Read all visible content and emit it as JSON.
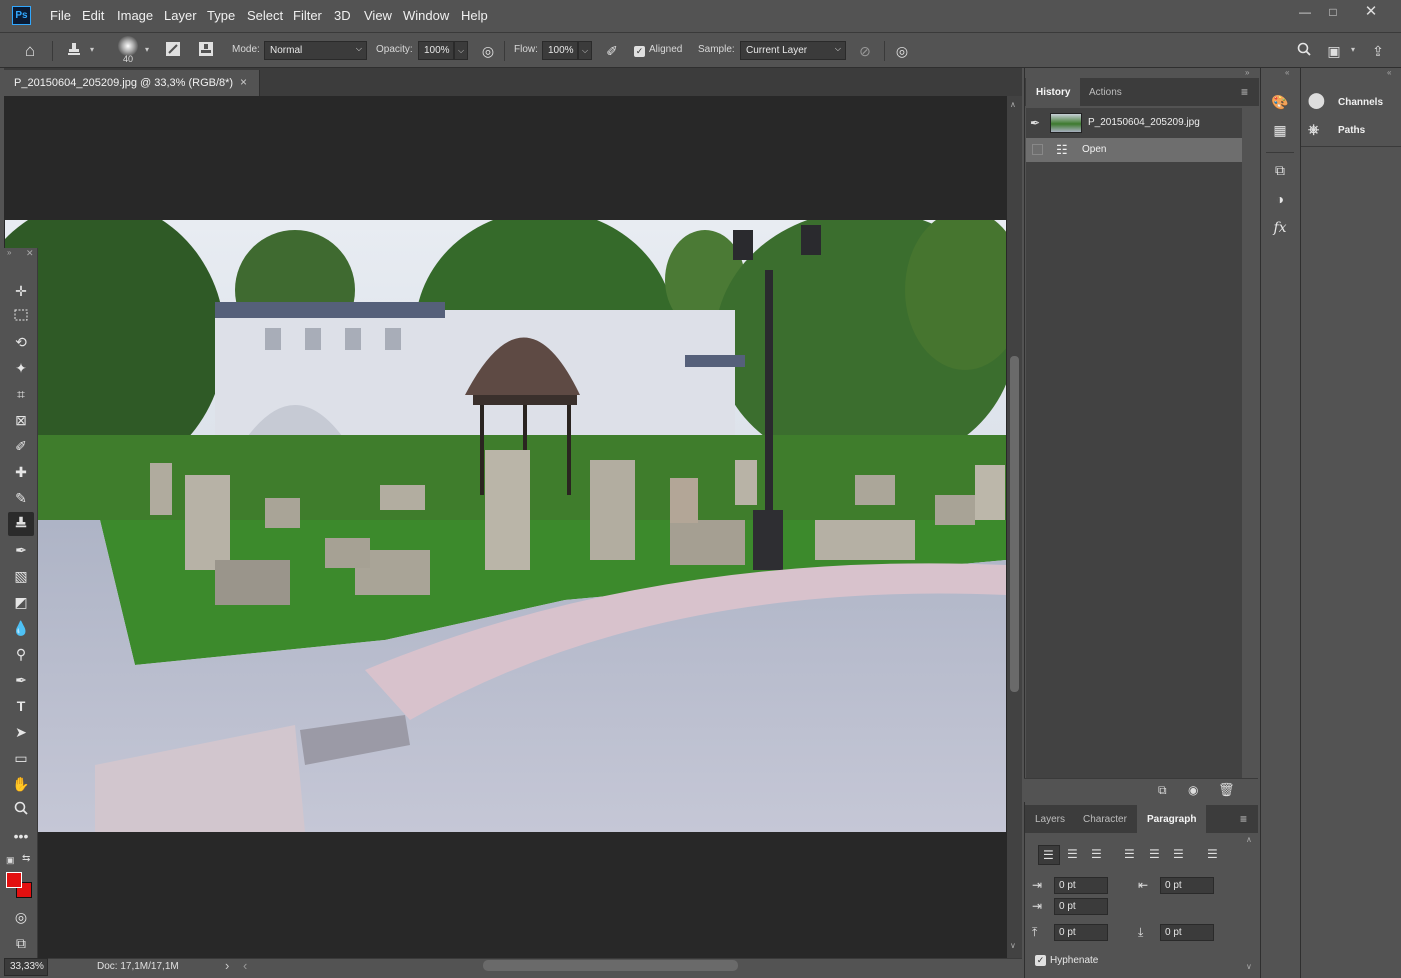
{
  "app": {
    "logo": "Ps"
  },
  "menu": [
    "File",
    "Edit",
    "Image",
    "Layer",
    "Type",
    "Select",
    "Filter",
    "3D",
    "View",
    "Window",
    "Help"
  ],
  "options": {
    "brush_size": "40",
    "mode_label": "Mode:",
    "mode_value": "Normal",
    "opacity_label": "Opacity:",
    "opacity_value": "100%",
    "flow_label": "Flow:",
    "flow_value": "100%",
    "aligned_label": "Aligned",
    "sample_label": "Sample:",
    "sample_value": "Current Layer"
  },
  "document": {
    "tab_title": "P_20150604_205209.jpg @ 33,3% (RGB/8*)",
    "close_glyph": "×"
  },
  "status": {
    "zoom": "33,33%",
    "doc_info": "Doc: 17,1M/17,1M",
    "arrow_right": "›",
    "arrow_left": "‹"
  },
  "history_panel": {
    "tabs": [
      "History",
      "Actions"
    ],
    "active_tab": "History",
    "snapshot_name": "P_20150604_205209.jpg",
    "steps": [
      "Open"
    ]
  },
  "paragraph_panel": {
    "tabs": [
      "Layers",
      "Character",
      "Paragraph"
    ],
    "active_tab": "Paragraph",
    "indent_left": "0 pt",
    "indent_right": "0 pt",
    "indent_first": "0 pt",
    "space_before": "0 pt",
    "space_after": "0 pt",
    "hyphenate_label": "Hyphenate"
  },
  "side_panel": {
    "items": [
      "Channels",
      "Paths"
    ]
  },
  "colors": {
    "foreground": "#e31010",
    "background": "#e31010",
    "accent": "#31a8ff"
  }
}
